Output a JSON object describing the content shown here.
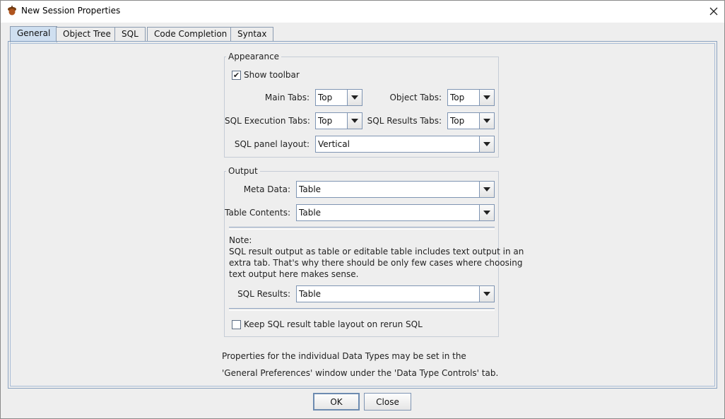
{
  "window": {
    "title": "New Session Properties",
    "app_icon": "acorn-icon",
    "close_icon": "close-icon"
  },
  "tabs": [
    "General",
    "Object Tree",
    "SQL",
    "Code Completion",
    "Syntax"
  ],
  "appearance": {
    "title": "Appearance",
    "show_toolbar_label": "Show toolbar",
    "show_toolbar_checked": true,
    "main_tabs_label": "Main Tabs:",
    "main_tabs_value": "Top",
    "object_tabs_label": "Object Tabs:",
    "object_tabs_value": "Top",
    "sql_exec_tabs_label": "SQL Execution Tabs:",
    "sql_exec_tabs_value": "Top",
    "sql_results_tabs_label": "SQL Results Tabs:",
    "sql_results_tabs_value": "Top",
    "sql_panel_layout_label": "SQL panel layout:",
    "sql_panel_layout_value": "Vertical"
  },
  "output": {
    "title": "Output",
    "meta_data_label": "Meta Data:",
    "meta_data_value": "Table",
    "table_contents_label": "Table Contents:",
    "table_contents_value": "Table",
    "note_lines": [
      "Note:",
      "SQL result output as table or editable table includes text output in an",
      "extra tab. That's why there should be only few cases where choosing",
      "text output here makes sense."
    ],
    "sql_results_label": "SQL Results:",
    "sql_results_value": "Table",
    "keep_layout_label": "Keep SQL result table layout on rerun SQL",
    "keep_layout_checked": false
  },
  "footer_text": [
    "Properties for the individual Data Types may be set in the",
    "'General Preferences' window under the 'Data Type Controls' tab."
  ],
  "buttons": {
    "ok": "OK",
    "close": "Close"
  },
  "active_tab_color": "#cfdff0",
  "accent_border": "#7f95b3"
}
